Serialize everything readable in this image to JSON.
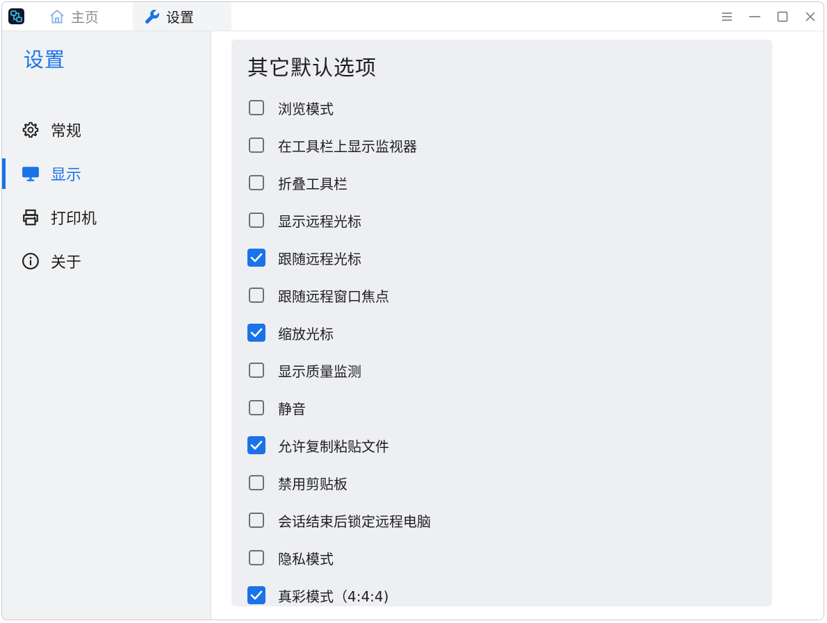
{
  "titlebar": {
    "tabs": [
      {
        "label": "主页",
        "icon": "home-icon",
        "active": false
      },
      {
        "label": "设置",
        "icon": "wrench-icon",
        "active": true
      }
    ],
    "controls": [
      "menu-icon",
      "minimize-icon",
      "maximize-icon",
      "close-icon"
    ]
  },
  "sidebar": {
    "title": "设置",
    "items": [
      {
        "label": "常规",
        "icon": "gear-icon",
        "active": false
      },
      {
        "label": "显示",
        "icon": "monitor-icon",
        "active": true
      },
      {
        "label": "打印机",
        "icon": "printer-icon",
        "active": false
      },
      {
        "label": "关于",
        "icon": "info-icon",
        "active": false
      }
    ]
  },
  "main": {
    "section_title": "其它默认选项",
    "options": [
      {
        "label": "浏览模式",
        "checked": false
      },
      {
        "label": "在工具栏上显示监视器",
        "checked": false
      },
      {
        "label": "折叠工具栏",
        "checked": false
      },
      {
        "label": "显示远程光标",
        "checked": false
      },
      {
        "label": "跟随远程光标",
        "checked": true
      },
      {
        "label": "跟随远程窗口焦点",
        "checked": false
      },
      {
        "label": "缩放光标",
        "checked": true
      },
      {
        "label": "显示质量监测",
        "checked": false
      },
      {
        "label": "静音",
        "checked": false
      },
      {
        "label": "允许复制粘贴文件",
        "checked": true
      },
      {
        "label": "禁用剪贴板",
        "checked": false
      },
      {
        "label": "会话结束后锁定远程电脑",
        "checked": false
      },
      {
        "label": "隐私模式",
        "checked": false
      },
      {
        "label": "真彩模式（4:4:4)",
        "checked": true
      }
    ]
  },
  "colors": {
    "accent": "#1a73e8",
    "sidebar_bg": "#f1f2f4",
    "card_bg": "#eeeff2"
  }
}
